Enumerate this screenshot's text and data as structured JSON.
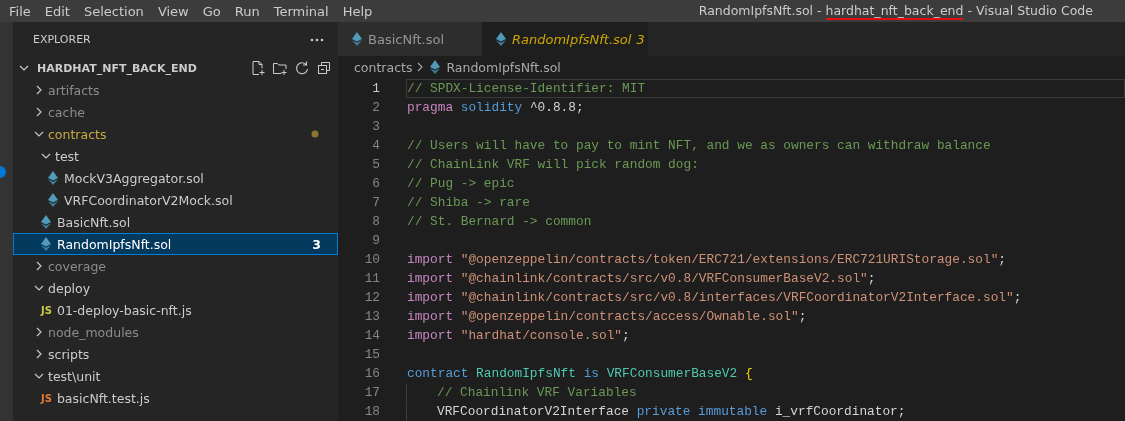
{
  "menu": [
    "File",
    "Edit",
    "Selection",
    "View",
    "Go",
    "Run",
    "Terminal",
    "Help"
  ],
  "title_parts": [
    {
      "text": "RandomIpfsNft.sol - ",
      "underlined": false
    },
    {
      "text": "hardhat_nft_back_end",
      "underlined": true
    },
    {
      "text": " - Visual Studio Code",
      "underlined": false
    }
  ],
  "explorer": {
    "title": "EXPLORER",
    "project": {
      "label": "HARDHAT_NFT_BACK_END",
      "expanded": true
    },
    "items": [
      {
        "name": "artifacts",
        "kind": "folder",
        "expanded": false,
        "dimmed": true,
        "modified": false,
        "selected": false
      },
      {
        "name": "cache",
        "kind": "folder",
        "expanded": false,
        "dimmed": true,
        "modified": false,
        "selected": false
      },
      {
        "name": "contracts",
        "kind": "folder",
        "expanded": true,
        "dimmed": false,
        "modified": true,
        "selected": false,
        "children": [
          {
            "name": "test",
            "kind": "folder",
            "expanded": true,
            "dimmed": false,
            "modified": false,
            "selected": false,
            "children": [
              {
                "name": "MockV3Aggregator.sol",
                "kind": "sol",
                "selected": false
              },
              {
                "name": "VRFCoordinatorV2Mock.sol",
                "kind": "sol",
                "selected": false
              }
            ]
          },
          {
            "name": "BasicNft.sol",
            "kind": "sol",
            "selected": false
          },
          {
            "name": "RandomIpfsNft.sol",
            "kind": "sol",
            "selected": true,
            "badge": "3"
          }
        ]
      },
      {
        "name": "coverage",
        "kind": "folder",
        "expanded": false,
        "dimmed": true,
        "modified": false,
        "selected": false
      },
      {
        "name": "deploy",
        "kind": "folder",
        "expanded": true,
        "dimmed": false,
        "modified": false,
        "selected": false,
        "children": [
          {
            "name": "01-deploy-basic-nft.js",
            "kind": "js",
            "icon": "JS",
            "color": "#cbcb41",
            "selected": false
          }
        ]
      },
      {
        "name": "node_modules",
        "kind": "folder",
        "expanded": false,
        "dimmed": true,
        "modified": false,
        "selected": false
      },
      {
        "name": "scripts",
        "kind": "folder",
        "expanded": false,
        "dimmed": false,
        "modified": false,
        "selected": false
      },
      {
        "name": "test\\unit",
        "kind": "folder",
        "expanded": true,
        "dimmed": false,
        "modified": false,
        "selected": false,
        "children": [
          {
            "name": "basicNft.test.js",
            "kind": "js",
            "icon": "JS",
            "color": "#e37933",
            "selected": false
          }
        ]
      }
    ]
  },
  "tabs": [
    {
      "label": "BasicNft.sol",
      "selected": false
    },
    {
      "label": "RandomIpfsNft.sol",
      "selected": true,
      "badge": "3"
    }
  ],
  "breadcrumb": [
    "contracts",
    "RandomIpfsNft.sol"
  ],
  "code": [
    {
      "n": "1",
      "current": true,
      "tokens": [
        {
          "t": "// SPDX-License-Identifier: MIT",
          "kind": "comment"
        }
      ]
    },
    {
      "n": "2",
      "current": false,
      "tokens": [
        {
          "t": "pragma",
          "kind": "keyword"
        },
        {
          "t": " solidity",
          "kind": "storage"
        },
        {
          "t": " ^0.8.8;",
          "kind": "plain"
        }
      ]
    },
    {
      "n": "3",
      "current": false
    },
    {
      "n": "4",
      "current": false,
      "tokens": [
        {
          "t": "// Users will have to pay to mint NFT, and we as owners can withdraw balance",
          "kind": "comment"
        }
      ]
    },
    {
      "n": "5",
      "current": false,
      "tokens": [
        {
          "t": "// ChainLink VRF will pick random dog:",
          "kind": "comment"
        }
      ]
    },
    {
      "n": "6",
      "current": false,
      "tokens": [
        {
          "t": "// Pug -> epic",
          "kind": "comment"
        }
      ]
    },
    {
      "n": "7",
      "current": false,
      "tokens": [
        {
          "t": "// Shiba -> rare",
          "kind": "comment"
        }
      ]
    },
    {
      "n": "8",
      "current": false,
      "tokens": [
        {
          "t": "// St. Bernard -> common",
          "kind": "comment"
        }
      ]
    },
    {
      "n": "9",
      "current": false
    },
    {
      "n": "10",
      "current": false,
      "tokens": [
        {
          "t": "import",
          "kind": "keyword"
        },
        {
          "t": " \"@openzeppelin/contracts/token/ERC721/extensions/ERC721URIStorage.sol\"",
          "kind": "string"
        },
        {
          "t": ";",
          "kind": "plain"
        }
      ]
    },
    {
      "n": "11",
      "current": false,
      "tokens": [
        {
          "t": "import",
          "kind": "keyword"
        },
        {
          "t": " \"@chainlink/contracts/src/v0.8/VRFConsumerBaseV2.sol\"",
          "kind": "string"
        },
        {
          "t": ";",
          "kind": "plain"
        }
      ]
    },
    {
      "n": "12",
      "current": false,
      "tokens": [
        {
          "t": "import",
          "kind": "keyword"
        },
        {
          "t": " \"@chainlink/contracts/src/v0.8/interfaces/VRFCoordinatorV2Interface.sol\"",
          "kind": "string"
        },
        {
          "t": ";",
          "kind": "plain"
        }
      ]
    },
    {
      "n": "13",
      "current": false,
      "tokens": [
        {
          "t": "import",
          "kind": "keyword"
        },
        {
          "t": " \"@openzeppelin/contracts/access/Ownable.sol\"",
          "kind": "string"
        },
        {
          "t": ";",
          "kind": "plain"
        }
      ]
    },
    {
      "n": "14",
      "current": false,
      "tokens": [
        {
          "t": "import",
          "kind": "keyword"
        },
        {
          "t": " \"hardhat/console.sol\"",
          "kind": "string"
        },
        {
          "t": ";",
          "kind": "plain"
        }
      ]
    },
    {
      "n": "15",
      "current": false
    },
    {
      "n": "16",
      "current": false,
      "tokens": [
        {
          "t": "contract",
          "kind": "storage"
        },
        {
          "t": " RandomIpfsNft",
          "kind": "type"
        },
        {
          "t": " is",
          "kind": "storage"
        },
        {
          "t": " VRFConsumerBaseV2",
          "kind": "type"
        },
        {
          "t": " {",
          "kind": "bracket"
        }
      ]
    },
    {
      "n": "17",
      "current": false,
      "indent": true,
      "tokens": [
        {
          "t": "// Chainlink VRF Variables",
          "kind": "comment"
        }
      ]
    },
    {
      "n": "18",
      "current": false,
      "indent": true,
      "tokens": [
        {
          "t": "VRFCoordinatorV2Interface",
          "kind": "plain"
        },
        {
          "t": " private",
          "kind": "storage"
        },
        {
          "t": " immutable",
          "kind": "storage"
        },
        {
          "t": " i_vrfCoordinator;",
          "kind": "plain"
        }
      ]
    }
  ]
}
